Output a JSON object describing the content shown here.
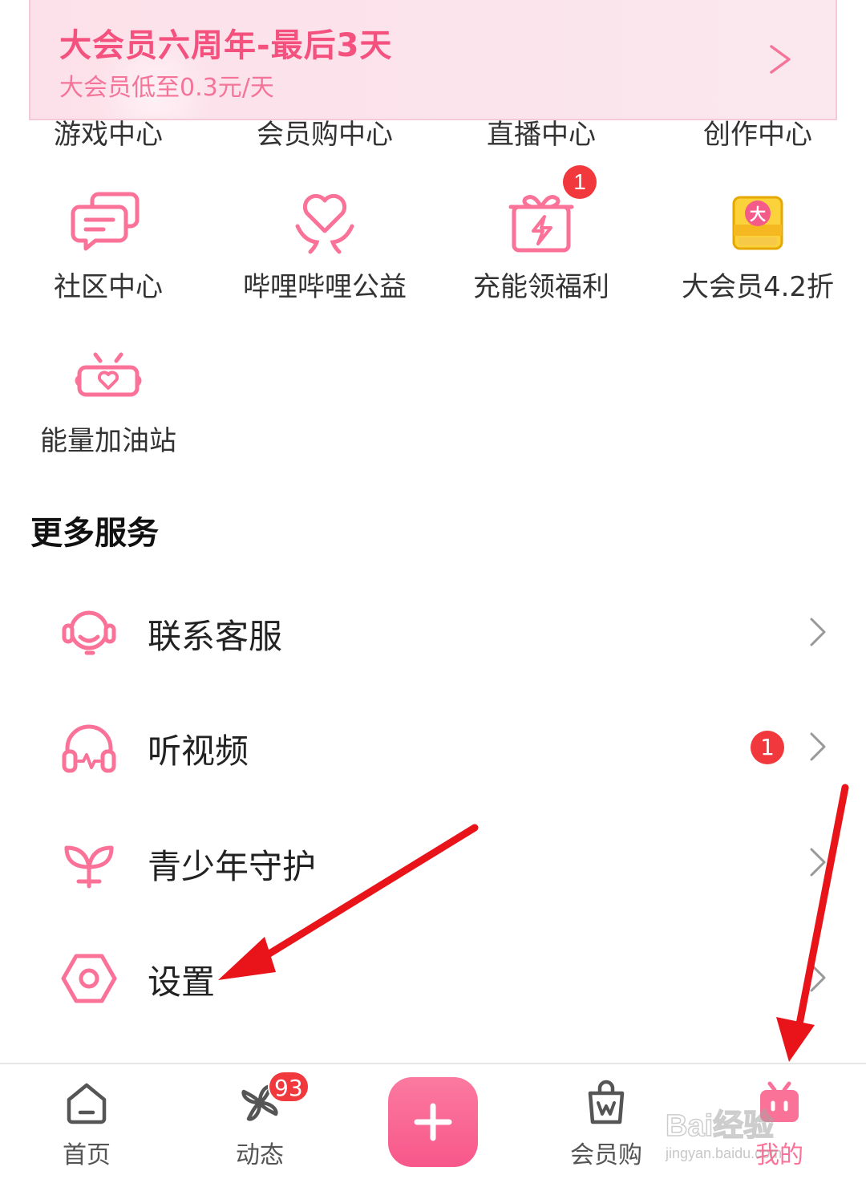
{
  "banner": {
    "title": "大会员六周年-最后3天",
    "subtitle": "大会员低至0.3元/天"
  },
  "grid_partial_row": [
    {
      "label": "游戏中心"
    },
    {
      "label": "会员购中心"
    },
    {
      "label": "直播中心"
    },
    {
      "label": "创作中心"
    }
  ],
  "grid_items": [
    {
      "label": "社区中心",
      "icon": "chat-bubbles-icon"
    },
    {
      "label": "哔哩哔哩公益",
      "icon": "heart-hands-icon"
    },
    {
      "label": "充能领福利",
      "icon": "gift-lightning-icon",
      "badge": "1"
    },
    {
      "label": "大会员4.2折",
      "icon": "vip-chest-icon",
      "icon_text": "大"
    },
    {
      "label": "能量加油站",
      "icon": "tv-heart-icon"
    }
  ],
  "more_services": {
    "title": "更多服务",
    "items": [
      {
        "label": "联系客服",
        "icon": "headset-icon"
      },
      {
        "label": "听视频",
        "icon": "headphones-icon",
        "badge": "1"
      },
      {
        "label": "青少年守护",
        "icon": "sprout-icon"
      },
      {
        "label": "设置",
        "icon": "settings-hexagon-icon"
      }
    ]
  },
  "bottom_nav": {
    "items": [
      {
        "label": "首页",
        "icon": "home-icon"
      },
      {
        "label": "动态",
        "icon": "pinwheel-icon",
        "badge": "93"
      },
      {
        "label": "",
        "icon": "plus-icon"
      },
      {
        "label": "会员购",
        "icon": "shopping-bag-icon"
      },
      {
        "label": "我的",
        "icon": "tv-icon",
        "active": true
      }
    ]
  },
  "watermark": {
    "text": "Bai经验",
    "sub": "jingyan.baidu.com"
  },
  "colors": {
    "accent": "#fb7299",
    "badge": "#f1383c",
    "arrow": "#e8141a"
  }
}
